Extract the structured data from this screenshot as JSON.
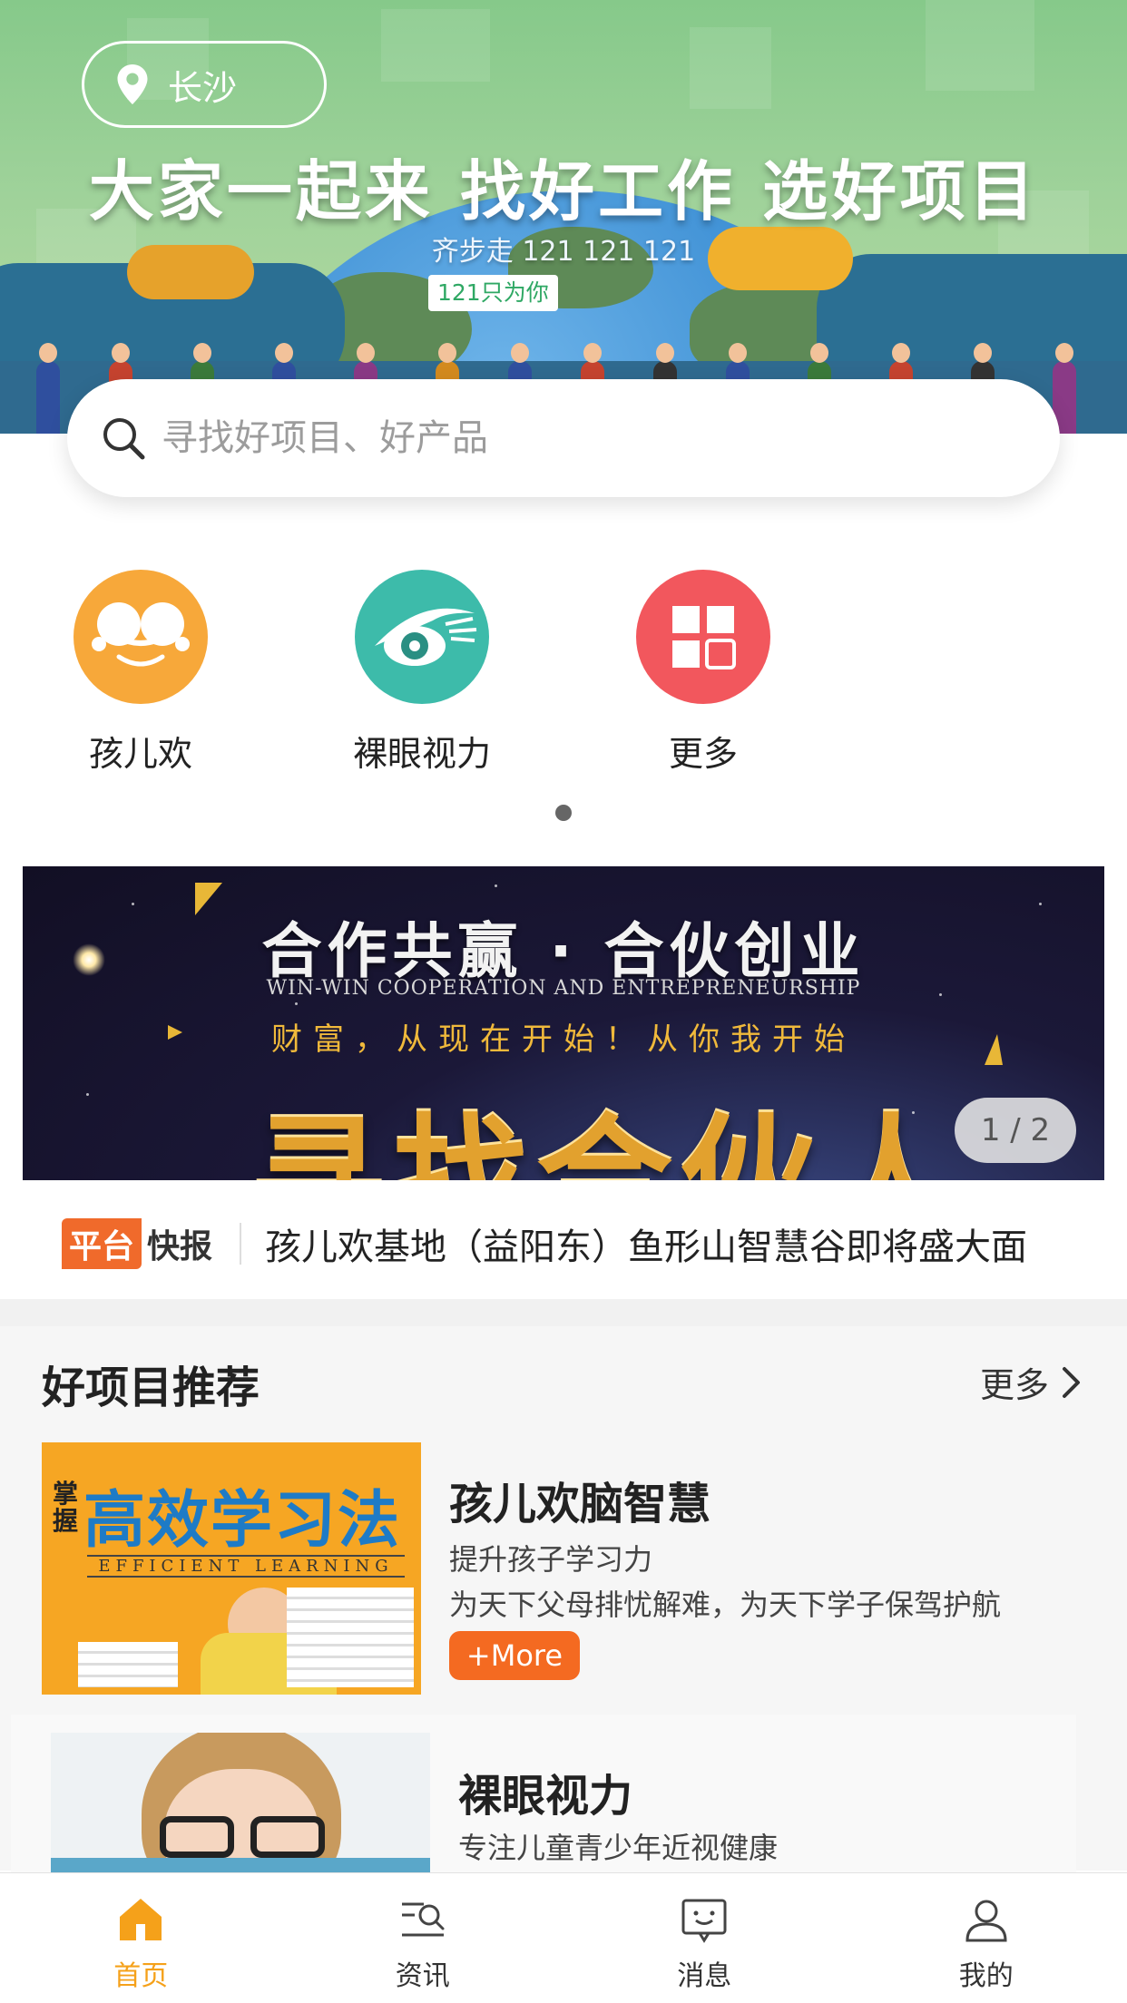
{
  "hero": {
    "location": "长沙",
    "title": "大家一起来 找好工作 选好项目",
    "subtitle": "齐步走 121 121 121",
    "badge": "121只为你"
  },
  "search": {
    "placeholder": "寻找好项目、好产品"
  },
  "categories": [
    {
      "label": "孩儿欢",
      "icon": "kid-face-icon",
      "color": "#f7a83a"
    },
    {
      "label": "裸眼视力",
      "icon": "eye-icon",
      "color": "#3dbbaa"
    },
    {
      "label": "更多",
      "icon": "grid-icon",
      "color": "#f2575d"
    }
  ],
  "banner": {
    "title": "合作共赢 · 合伙创业",
    "subtitle_en": "WIN-WIN COOPERATION AND ENTREPRENEURSHIP",
    "slogan": "财富，从现在开始！从你我开始",
    "big_text": "寻找合伙人",
    "counter": "1 / 2"
  },
  "ticker": {
    "tag_a": "平台",
    "tag_b": "快报",
    "text": "孩儿欢基地（益阳东）鱼形山智慧谷即将盛大面"
  },
  "recommend": {
    "title": "好项目推荐",
    "more": "更多",
    "items": [
      {
        "name": "孩儿欢脑智慧",
        "desc1": "提升孩子学习力",
        "desc2": "为天下父母排忧解难，为天下学子保驾护航",
        "button": "+More",
        "image_text_small": "掌握",
        "image_text": "高效学习法",
        "image_text_en": "EFFICIENT LEARNING"
      },
      {
        "name": "裸眼视力",
        "desc1": "专注儿童青少年近视健康"
      }
    ]
  },
  "tabbar": [
    {
      "label": "首页",
      "icon": "home-icon",
      "active": true
    },
    {
      "label": "资讯",
      "icon": "news-search-icon",
      "active": false
    },
    {
      "label": "消息",
      "icon": "message-icon",
      "active": false
    },
    {
      "label": "我的",
      "icon": "profile-icon",
      "active": false
    }
  ],
  "colors": {
    "accent": "#f5a11a",
    "button": "#f46a21",
    "tag": "#f06a2b"
  }
}
